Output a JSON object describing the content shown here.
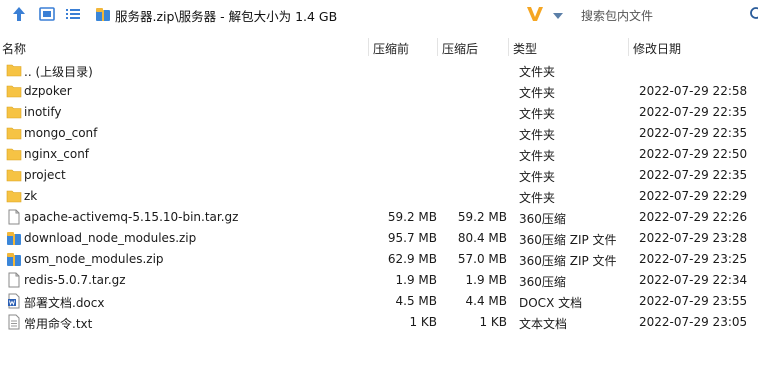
{
  "toolbar": {
    "path": "服务器.zip\\服务器 - 解包大小为 1.4 GB",
    "search_placeholder": "搜索包内文件"
  },
  "columns": {
    "name": "名称",
    "compressed": "压缩前",
    "uncompressed": "压缩后",
    "type": "类型",
    "modified": "修改日期"
  },
  "files": [
    {
      "icon": "folder-icon",
      "name": ".. (上级目录)",
      "before": "",
      "after": "",
      "type": "文件夹",
      "date": ""
    },
    {
      "icon": "folder-icon",
      "name": "dzpoker",
      "before": "",
      "after": "",
      "type": "文件夹",
      "date": "2022-07-29 22:58"
    },
    {
      "icon": "folder-icon",
      "name": "inotify",
      "before": "",
      "after": "",
      "type": "文件夹",
      "date": "2022-07-29 22:35"
    },
    {
      "icon": "folder-icon",
      "name": "mongo_conf",
      "before": "",
      "after": "",
      "type": "文件夹",
      "date": "2022-07-29 22:35"
    },
    {
      "icon": "folder-icon",
      "name": "nginx_conf",
      "before": "",
      "after": "",
      "type": "文件夹",
      "date": "2022-07-29 22:50"
    },
    {
      "icon": "folder-icon",
      "name": "project",
      "before": "",
      "after": "",
      "type": "文件夹",
      "date": "2022-07-29 22:35"
    },
    {
      "icon": "folder-icon",
      "name": "zk",
      "before": "",
      "after": "",
      "type": "文件夹",
      "date": "2022-07-29 22:29"
    },
    {
      "icon": "file-icon",
      "name": "apache-activemq-5.15.10-bin.tar.gz",
      "before": "59.2 MB",
      "after": "59.2 MB",
      "type": "360压缩",
      "date": "2022-07-29 22:26"
    },
    {
      "icon": "zip-archive-icon",
      "name": "download_node_modules.zip",
      "before": "95.7 MB",
      "after": "80.4 MB",
      "type": "360压缩 ZIP 文件",
      "date": "2022-07-29 23:28"
    },
    {
      "icon": "zip-archive-icon",
      "name": "osm_node_modules.zip",
      "before": "62.9 MB",
      "after": "57.0 MB",
      "type": "360压缩 ZIP 文件",
      "date": "2022-07-29 23:25"
    },
    {
      "icon": "file-icon",
      "name": "redis-5.0.7.tar.gz",
      "before": "1.9 MB",
      "after": "1.9 MB",
      "type": "360压缩",
      "date": "2022-07-29 22:34"
    },
    {
      "icon": "word-doc-icon",
      "name": "部署文档.docx",
      "before": "4.5 MB",
      "after": "4.4 MB",
      "type": "DOCX 文档",
      "date": "2022-07-29 23:55"
    },
    {
      "icon": "text-file-icon",
      "name": "常用命令.txt",
      "before": "1 KB",
      "after": "1 KB",
      "type": "文本文档",
      "date": "2022-07-29 23:05"
    }
  ],
  "colors": {
    "folder": "#f6c344",
    "accent": "#1e6fd9",
    "v_logo": "#f5a623"
  }
}
